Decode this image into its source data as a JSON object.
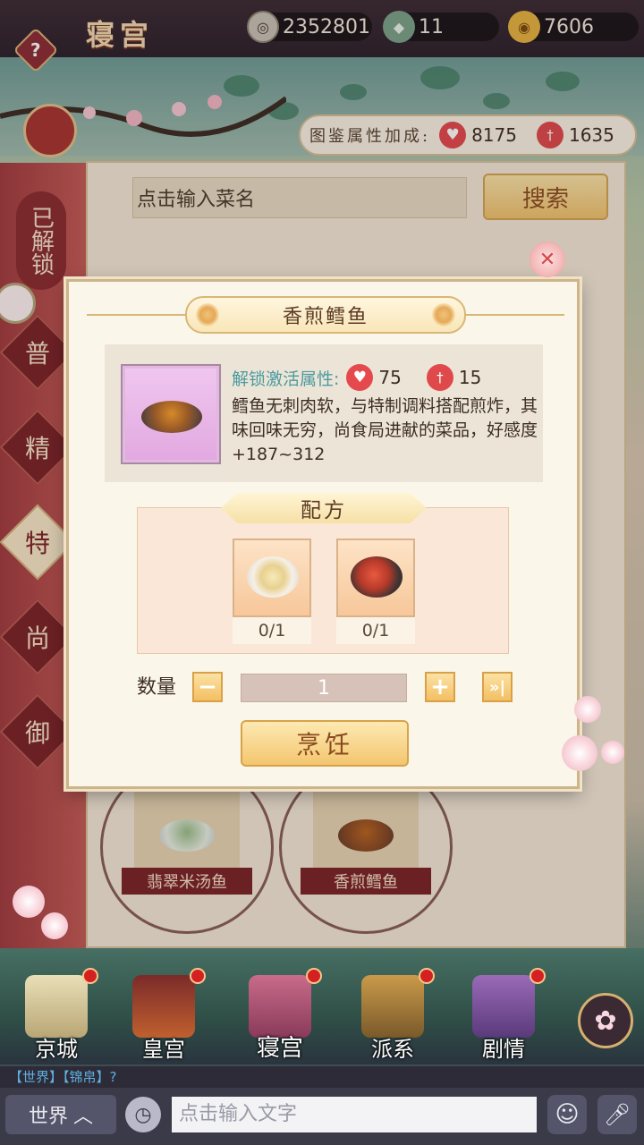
{
  "topbar": {
    "help": "?",
    "title": "寝宫",
    "resources": [
      {
        "icon": "coin-icon",
        "value": "2352801"
      },
      {
        "icon": "jade-icon",
        "value": "11"
      },
      {
        "icon": "gold-ingot-icon",
        "value": "7606"
      }
    ]
  },
  "bonus": {
    "label": "图鉴属性加成:",
    "heart_value": "8175",
    "sword_value": "1635"
  },
  "search": {
    "placeholder": "点击输入菜名",
    "button": "搜索"
  },
  "tabs": {
    "unlocked": "已解锁",
    "items": [
      "普",
      "精",
      "特",
      "尚",
      "御"
    ],
    "active": "特"
  },
  "dishes": [
    {
      "name": "翡翠米汤鱼"
    },
    {
      "name": "香煎鳕鱼"
    }
  ],
  "modal": {
    "title": "香煎鳕鱼",
    "unlock_label": "解锁激活属性:",
    "heart_value": "75",
    "sword_value": "15",
    "description": "鳕鱼无刺肉软，与特制调料搭配煎炸，其味回味无穷，尚食局进献的菜品，好感度+187~312",
    "recipe_title": "配方",
    "ingredients": [
      {
        "icon": "sauce-bowl-icon",
        "count": "0/1"
      },
      {
        "icon": "raw-fish-icon",
        "count": "0/1"
      }
    ],
    "quantity_label": "数量",
    "quantity_value": "1",
    "cook_button": "烹饪"
  },
  "nav": [
    {
      "label": "京城",
      "badge": true
    },
    {
      "label": "皇宫",
      "badge": true
    },
    {
      "label": "寝宫",
      "badge": true,
      "active": true
    },
    {
      "label": "派系",
      "badge": true
    },
    {
      "label": "剧情",
      "badge": true
    }
  ],
  "chat": {
    "last_line": "【世界】【锦帛】?",
    "channel": "世界",
    "placeholder": "点击输入文字"
  },
  "colors": {
    "accent_red": "#7b2226",
    "gold": "#f3c66f",
    "teal_label": "#4b9aa0"
  }
}
